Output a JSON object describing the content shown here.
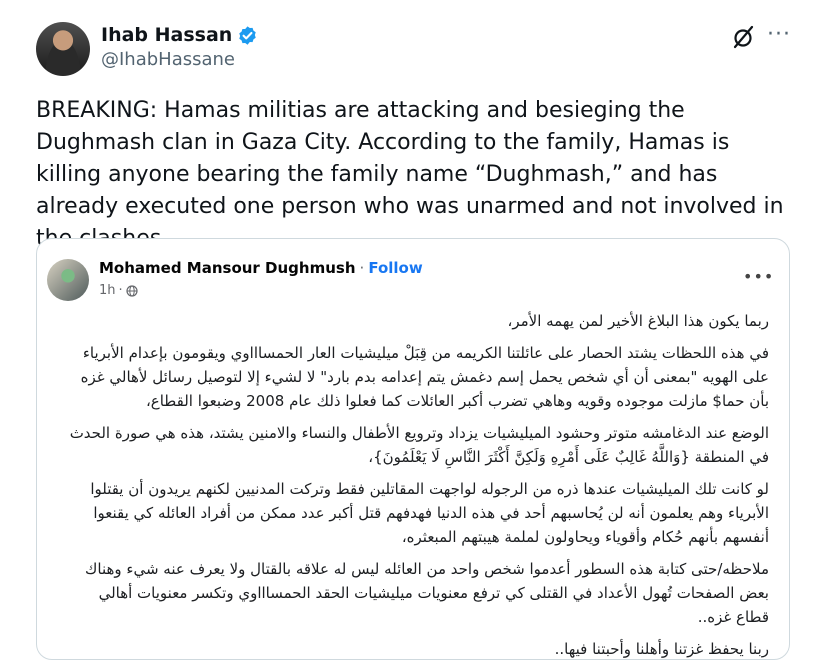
{
  "tweet": {
    "author_name": "Ihab Hassan",
    "author_handle": "@IhabHassane",
    "text": "BREAKING: Hamas militias are attacking and besieging the Dughmash clan in Gaza City. According to the family, Hamas is killing anyone bearing the family name “Dughmash,” and has already executed one person who was unarmed and not involved in the clashes.",
    "icons": {
      "verified": "verified-badge-icon",
      "grok": "grok-icon",
      "more": "more-icon"
    },
    "colors": {
      "verified": "#1d9bf0",
      "text": "#0f1419",
      "secondary": "#536471"
    }
  },
  "embedded_post": {
    "author_name": "Mohamed Mansour Dughmush",
    "separator": "·",
    "follow_label": "Follow",
    "timestamp": "1h",
    "meta_separator": "·",
    "icons": {
      "privacy": "globe-icon",
      "more": "more-icon"
    },
    "colors": {
      "follow": "#1877f2",
      "text": "#1c1e21",
      "meta": "#65676b"
    },
    "paragraphs": [
      "ربما يكون هذا البلاغ الأخير لمن يهمه الأمر،",
      "في هذه اللحظات يشتد الحصار على عائلتنا الكريمه من قِبَلْ ميليشيات العار الحمساااوي ويقومون بإعدام الأبرياء على الهويه \"بمعنى أن أي شخص يحمل إسم دغمش يتم إعدامه بدم بارد\" لا لشيء إلا لتوصيل رسائل لأهالي غزه بأن حما$ مازلت موجوده وقويه وهاهي تضرب أكبر العائلات كما فعلوا ذلك عام 2008 وضبعوا القطاع،",
      "الوضع عند الدغامشه متوتر وحشود الميليشيات يزداد وترويع الأطفال والنساء والامنين يشتد، هذه هي صورة الحدث في المنطقة {وَاللَّهُ غَالِبٌ عَلَى أَمْرِهِ وَلَكِنَّ أَكْثَرَ النَّاسِ لَا يَعْلَمُونَ}،",
      "لو كانت تلك الميليشيات عندها ذره من الرجوله لواجهت المقاتلين فقط وتركت المدنيين لكنهم يريدون أن يقتلوا الأبرياء وهم يعلمون أنه لن يُحاسبهم أحد في هذه الدنيا فهدفهم قتل أكبر عدد ممكن من أفراد العائله كي يقنعوا أنفسهم بأنهم حُكام وأقوياء ويحاولون لملمة هيبتهم المبعثره،",
      "ملاحظه/حتى كتابة هذه السطور أعدموا شخص واحد من العائله ليس له علاقه بالقتال ولا يعرف عنه شيء وهناك بعض الصفحات تُهول الأعداد في القتلى كي ترفع معنويات ميليشيات الحقد الحمساااوي وتكسر معنويات أهالي قطاع غزه..",
      "ربنا يحفظ غزتنا وأهلنا وأحبتنا فيها.."
    ]
  }
}
